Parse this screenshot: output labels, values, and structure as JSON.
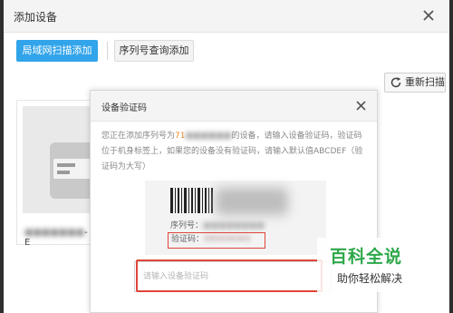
{
  "window": {
    "title": "添加设备"
  },
  "tabs": {
    "lan_scan_label": "局域网扫描添加",
    "serial_query_label": "序列号查询添加"
  },
  "toolbar": {
    "rescan_label": "重新扫描"
  },
  "device_card": {
    "name_suffix": "-E"
  },
  "verify_dialog": {
    "title": "设备验证码",
    "description_prefix": "您正在添加序列号为",
    "serial_partial": "71",
    "description_suffix": "的设备，请输入设备验证码，验证码位于机身标签上，如果您的设备没有验证码，请输入默认值ABCDEF（验证码为大写）",
    "label_serial": "序列号：",
    "label_code": "验证码：",
    "code_value": "585656565",
    "input_placeholder": "请输入设备验证码"
  },
  "watermark": {
    "title": "百科全说",
    "subtitle": "助你轻松解决"
  },
  "colors": {
    "primary_blue": "#31a4ea",
    "highlight_red": "#e0453a",
    "serial_orange": "#f08a24",
    "watermark_green": "#2ea84a"
  }
}
